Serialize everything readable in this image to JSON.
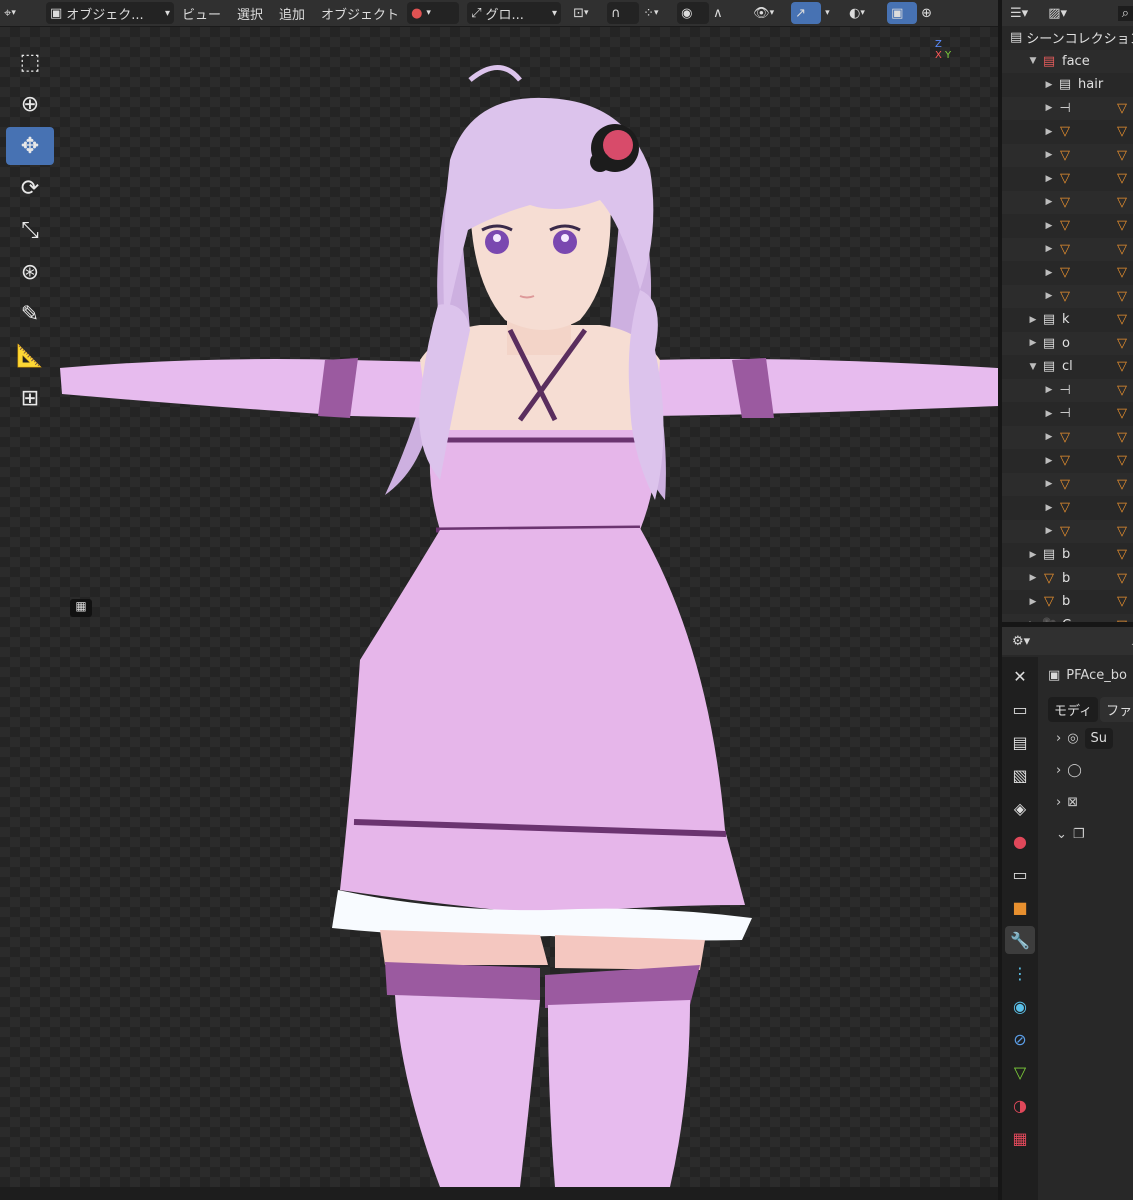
{
  "header": {
    "editor_type_icon": "3d-viewport-icon",
    "mode_label": "オブジェク...",
    "menus": [
      "ビュー",
      "選択",
      "追加",
      "オブジェクト"
    ],
    "transform_orientation": "グロ...",
    "pivot_icon": "pivot-icon"
  },
  "toolbar": {
    "tools": [
      "select-box-icon",
      "cursor-icon",
      "move-icon",
      "rotate-icon",
      "scale-icon",
      "transform-icon",
      "annotate-icon",
      "measure-icon",
      "add-cube-icon"
    ],
    "active_tool": "move-icon"
  },
  "gizmo": {
    "axes": [
      "Z",
      "X",
      "Y"
    ]
  },
  "outliner": {
    "rows": [
      {
        "name": "シーンコレクション",
        "depth": 0,
        "icon": "collection-icon"
      },
      {
        "name": "face",
        "depth": 1,
        "icon": "collection-red-icon",
        "expanded": true
      },
      {
        "name": "hair",
        "depth": 2,
        "icon": "collection-icon"
      },
      {
        "name": "",
        "depth": 2,
        "icon": "armature-icon"
      },
      {
        "name": "",
        "depth": 2,
        "icon": "mesh-icon"
      },
      {
        "name": "",
        "depth": 2,
        "icon": "mesh-icon"
      },
      {
        "name": "",
        "depth": 2,
        "icon": "mesh-icon"
      },
      {
        "name": "",
        "depth": 2,
        "icon": "mesh-icon"
      },
      {
        "name": "",
        "depth": 2,
        "icon": "mesh-icon"
      },
      {
        "name": "",
        "depth": 2,
        "icon": "mesh-icon"
      },
      {
        "name": "",
        "depth": 2,
        "icon": "mesh-icon"
      },
      {
        "name": "",
        "depth": 2,
        "icon": "mesh-icon"
      },
      {
        "name": "k",
        "depth": 1,
        "icon": "collection-icon"
      },
      {
        "name": "o",
        "depth": 1,
        "icon": "collection-icon"
      },
      {
        "name": "cl",
        "depth": 1,
        "icon": "collection-icon",
        "expanded": true
      },
      {
        "name": "",
        "depth": 2,
        "icon": "armature-icon"
      },
      {
        "name": "",
        "depth": 2,
        "icon": "armature-icon"
      },
      {
        "name": "",
        "depth": 2,
        "icon": "mesh-icon"
      },
      {
        "name": "",
        "depth": 2,
        "icon": "mesh-icon"
      },
      {
        "name": "",
        "depth": 2,
        "icon": "mesh-icon"
      },
      {
        "name": "",
        "depth": 2,
        "icon": "mesh-icon"
      },
      {
        "name": "",
        "depth": 2,
        "icon": "mesh-icon"
      },
      {
        "name": "b",
        "depth": 1,
        "icon": "collection-icon"
      },
      {
        "name": "b",
        "depth": 1,
        "icon": "mesh-icon"
      },
      {
        "name": "b",
        "depth": 1,
        "icon": "mesh-icon"
      },
      {
        "name": "C",
        "depth": 1,
        "icon": "camera-icon"
      }
    ]
  },
  "properties": {
    "object_name": "PFAce_bo",
    "mod_tabs": [
      "モディ",
      "ファイ"
    ],
    "modifiers": [
      {
        "icon": "subdivision-icon",
        "field": "Su"
      },
      {
        "icon": "lattice-icon",
        "field": ""
      },
      {
        "icon": "mirror-icon",
        "field": ""
      },
      {
        "icon": "solidify-icon",
        "field": ""
      }
    ],
    "tabs": [
      "tool-icon",
      "render-icon",
      "output-icon",
      "view-layer-icon",
      "scene-icon",
      "world-icon",
      "collection-icon",
      "object-icon",
      "modifier-icon",
      "particles-icon",
      "physics-icon",
      "constraints-icon",
      "data-icon",
      "material-icon",
      "texture-icon"
    ],
    "active_tab": "modifier-icon"
  },
  "colors": {
    "accent": "#4772b3",
    "outfit": "#e6b6ea",
    "hair": "#dcc3ec",
    "skin": "#f6ddd3"
  }
}
